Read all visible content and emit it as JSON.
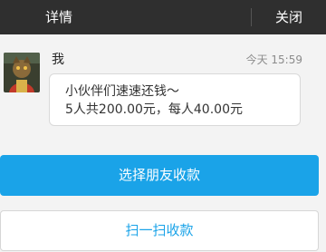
{
  "header": {
    "title": "详情",
    "close_label": "关闭"
  },
  "message": {
    "sender": "我",
    "timestamp": "今天 15:59",
    "line1": "小伙伴们速速还钱～",
    "line2": "5人共200.00元，每人40.00元"
  },
  "actions": {
    "select_friends_label": "选择朋友收款",
    "scan_label": "扫一扫收款"
  },
  "colors": {
    "header_bg": "#2f2f2f",
    "accent": "#1aa3e8",
    "page_bg": "#f3f3f3"
  }
}
